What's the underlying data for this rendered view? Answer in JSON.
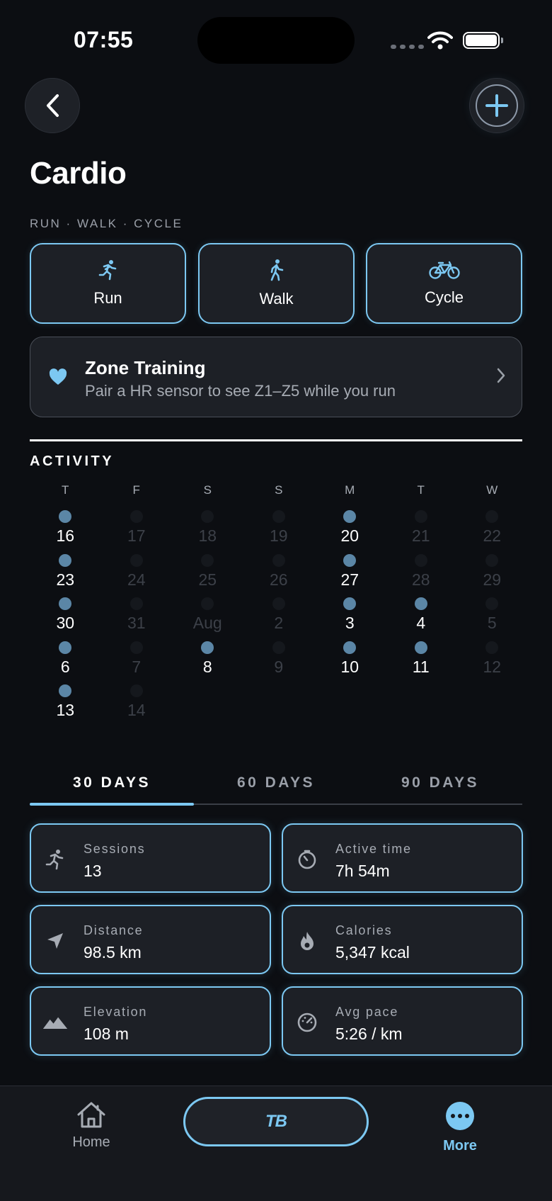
{
  "status_bar": {
    "time": "07:55"
  },
  "header": {
    "title": "Cardio",
    "subtitle": "RUN · WALK · CYCLE"
  },
  "activity_types": [
    {
      "label": "Run",
      "icon": "run-icon"
    },
    {
      "label": "Walk",
      "icon": "walk-icon"
    },
    {
      "label": "Cycle",
      "icon": "bike-icon"
    }
  ],
  "zone_training": {
    "title": "Zone Training",
    "subtitle": "Pair a HR sensor to see Z1–Z5 while you run"
  },
  "activity": {
    "label": "ACTIVITY",
    "weekdays": [
      "T",
      "F",
      "S",
      "S",
      "M",
      "T",
      "W"
    ],
    "days": [
      {
        "label": "16",
        "active": true
      },
      {
        "label": "17",
        "active": false
      },
      {
        "label": "18",
        "active": false
      },
      {
        "label": "19",
        "active": false
      },
      {
        "label": "20",
        "active": true
      },
      {
        "label": "21",
        "active": false
      },
      {
        "label": "22",
        "active": false
      },
      {
        "label": "23",
        "active": true
      },
      {
        "label": "24",
        "active": false
      },
      {
        "label": "25",
        "active": false
      },
      {
        "label": "26",
        "active": false
      },
      {
        "label": "27",
        "active": true
      },
      {
        "label": "28",
        "active": false
      },
      {
        "label": "29",
        "active": false
      },
      {
        "label": "30",
        "active": true
      },
      {
        "label": "31",
        "active": false
      },
      {
        "label": "Aug",
        "active": false
      },
      {
        "label": "2",
        "active": false
      },
      {
        "label": "3",
        "active": true
      },
      {
        "label": "4",
        "active": true
      },
      {
        "label": "5",
        "active": false
      },
      {
        "label": "6",
        "active": true
      },
      {
        "label": "7",
        "active": false
      },
      {
        "label": "8",
        "active": true
      },
      {
        "label": "9",
        "active": false
      },
      {
        "label": "10",
        "active": true
      },
      {
        "label": "11",
        "active": true
      },
      {
        "label": "12",
        "active": false
      },
      {
        "label": "13",
        "active": true
      },
      {
        "label": "14",
        "active": false
      }
    ]
  },
  "range_tabs": [
    {
      "label": "30 DAYS",
      "active": true
    },
    {
      "label": "60 DAYS",
      "active": false
    },
    {
      "label": "90 DAYS",
      "active": false
    }
  ],
  "stats": [
    {
      "label": "Sessions",
      "value": "13",
      "icon": "run-icon"
    },
    {
      "label": "Active time",
      "value": "7h 54m",
      "icon": "timer-icon"
    },
    {
      "label": "Distance",
      "value": "98.5 km",
      "icon": "location-arrow-icon"
    },
    {
      "label": "Calories",
      "value": "5,347 kcal",
      "icon": "flame-icon"
    },
    {
      "label": "Elevation",
      "value": "108 m",
      "icon": "mountains-icon"
    },
    {
      "label": "Avg pace",
      "value": "5:26 / km",
      "icon": "speedometer-icon"
    }
  ],
  "tab_bar": {
    "home": "Home",
    "logo": "TB",
    "more": "More"
  },
  "colors": {
    "accent": "#7cc8f2",
    "background": "#0c0e12",
    "card": "#1d2026",
    "active_dot": "#5b86a6"
  }
}
